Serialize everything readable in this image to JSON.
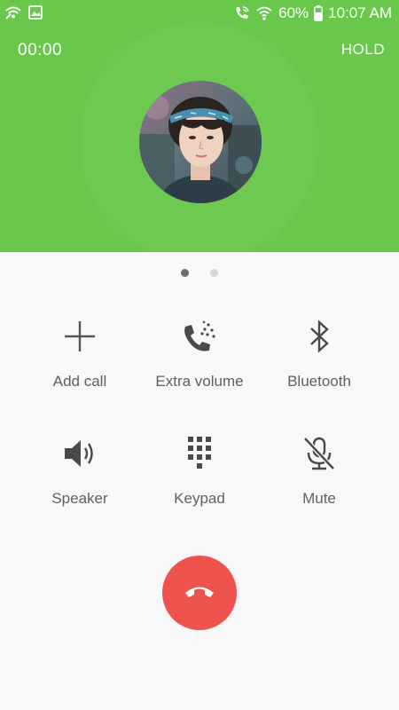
{
  "status_bar": {
    "battery": "60%",
    "time": "10:07 AM",
    "left_icons": [
      "signal-icon",
      "image-icon"
    ],
    "right_icons": [
      "call-wifi-icon",
      "wifi-icon",
      "battery-icon"
    ]
  },
  "call": {
    "timer": "00:00",
    "hold_label": "HOLD",
    "header_color": "#69c74b"
  },
  "pager": {
    "pages": 2,
    "active": 1
  },
  "actions": [
    {
      "label": "Add call",
      "icon": "plus-icon"
    },
    {
      "label": "Extra volume",
      "icon": "extra-volume-icon"
    },
    {
      "label": "Bluetooth",
      "icon": "bluetooth-icon"
    },
    {
      "label": "Speaker",
      "icon": "speaker-icon"
    },
    {
      "label": "Keypad",
      "icon": "keypad-icon"
    },
    {
      "label": "Mute",
      "icon": "mute-icon"
    }
  ],
  "end_call": {
    "icon": "end-call-icon",
    "color": "#ef5350"
  }
}
